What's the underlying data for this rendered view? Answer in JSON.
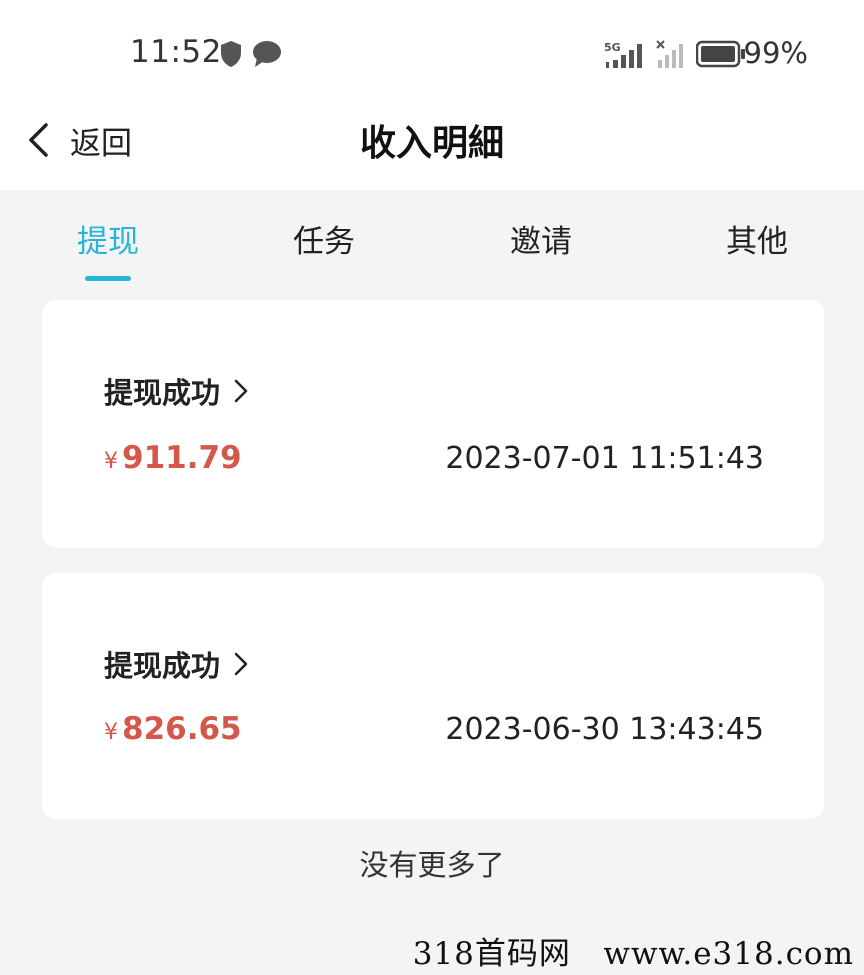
{
  "status_bar": {
    "time": "11:52",
    "battery": "99%",
    "icons": [
      "shield-icon",
      "message-icon",
      "5g-signal-icon",
      "no-signal-icon",
      "battery-icon"
    ]
  },
  "header": {
    "back_label": "返回",
    "title": "收入明細"
  },
  "tabs": [
    {
      "label": "提现",
      "active": true
    },
    {
      "label": "任务",
      "active": false
    },
    {
      "label": "邀请",
      "active": false
    },
    {
      "label": "其他",
      "active": false
    }
  ],
  "records": [
    {
      "status": "提现成功",
      "currency": "¥",
      "amount": "911.79",
      "datetime": "2023-07-01 11:51:43"
    },
    {
      "status": "提现成功",
      "currency": "¥",
      "amount": "826.65",
      "datetime": "2023-06-30 13:43:45"
    }
  ],
  "footer_text": "没有更多了",
  "watermark": "318首码网   www.e318.com",
  "colors": {
    "accent": "#27b4d8",
    "amount": "#d4584a",
    "background": "#f4f4f4",
    "card": "#ffffff"
  }
}
